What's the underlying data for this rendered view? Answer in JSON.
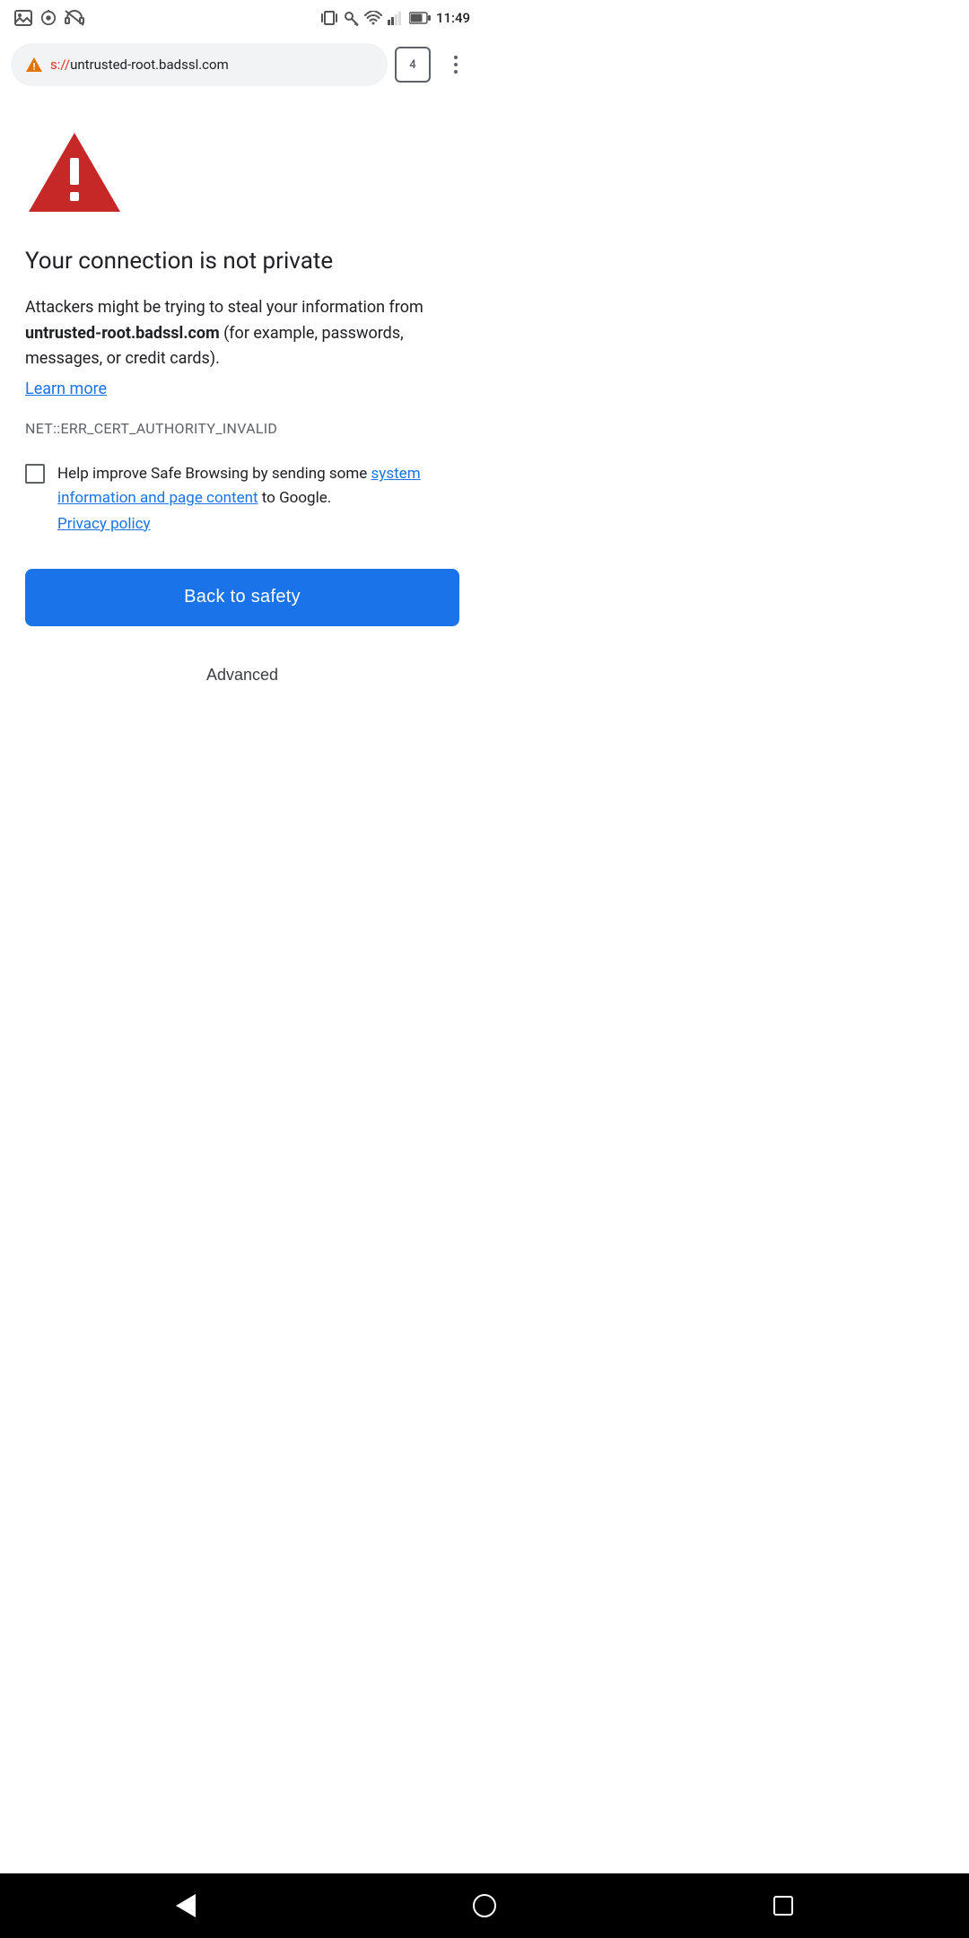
{
  "statusBar": {
    "time": "11:49",
    "icons": {
      "left": [
        "image-icon",
        "radio-icon",
        "no-headset-icon"
      ],
      "right": [
        "vibrate-icon",
        "key-icon",
        "wifi-icon",
        "signal-icon",
        "battery-icon"
      ]
    }
  },
  "addressBar": {
    "scheme": "s://",
    "url": "untrusted-root.badssl.com",
    "tabCount": "4",
    "warningPrefix": "⚠"
  },
  "page": {
    "title": "Your connection is not private",
    "descriptionPart1": "Attackers might be trying to steal your information from ",
    "siteName": "untrusted-root.badssl.com",
    "descriptionPart2": " (for example, passwords, messages, or credit cards).",
    "learnMoreLabel": "Learn more",
    "errorCode": "NET::ERR_CERT_AUTHORITY_INVALID",
    "checkboxLabel": "Help improve Safe Browsing by sending some ",
    "systemInfoLinkLabel": "system information and page content",
    "checkboxLabelSuffix": " to Google.",
    "privacyPolicyLabel": "Privacy policy",
    "backToSafetyLabel": "Back to safety",
    "advancedLabel": "Advanced"
  },
  "navBar": {
    "back": "back",
    "home": "home",
    "recent": "recent"
  }
}
